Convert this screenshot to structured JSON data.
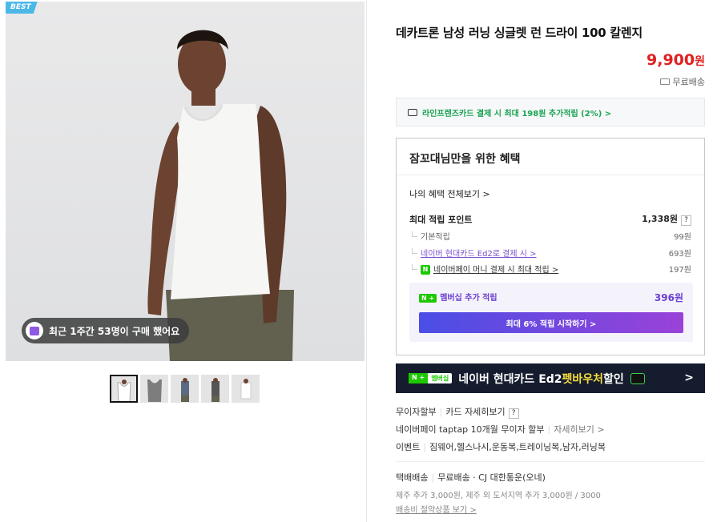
{
  "product": {
    "best_badge": "BEST",
    "recent_buyers": "최근 1주간 53명이 구매 했어요",
    "title": "데카트론 남성 러닝 싱글렛 런 드라이 100 칼렌지",
    "price": "9,900",
    "price_unit": "원",
    "shipping": "무료배송"
  },
  "card_promo": "라인프렌즈카드 결제 시 최대 198원 추가적립 (2%) >",
  "benefit": {
    "heading": "잠꼬대님만을 위한 혜택",
    "all_view": "나의 혜택 전체보기 >",
    "max_points_label": "최대 적립 포인트",
    "max_points_value": "1,338원",
    "help": "?",
    "basic_label": "기본적립",
    "basic_value": "99원",
    "naver_card_label": "네이버 현대카드 Ed2로 결제 시 >",
    "naver_card_value": "693원",
    "npay_icon": "N",
    "npay_label": "네이버페이 머니 결제 시 최대 적립 >",
    "npay_value": "197원",
    "membership_badge": "N +",
    "membership_label": "멤버십 추가 적립",
    "membership_value": "396원",
    "membership_button": "최대 6% 적립 시작하기 >"
  },
  "banner": {
    "badge_left": "N +",
    "badge_right": "멤버십",
    "text_main": "네이버 현대카드 Ed2 ",
    "text_highlight": "펫바우처",
    "text_tail": " 할인",
    "arrow": ">"
  },
  "payment": {
    "installment": "무이자할부",
    "card_detail": "카드 자세히보기",
    "help": "?",
    "taptap": "네이버페이 taptap 10개월 무이자 할부",
    "detail_more": "자세히보기 >",
    "event_label": "이벤트",
    "event_text": "짐웨어,헬스나시,운동복,트레이닝복,남자,러닝복"
  },
  "delivery": {
    "type": "택배배송",
    "free": "무료배송 · CJ 대한통운(오네)",
    "extra": "제주 추가 3,000원, 제주 외 도서지역 추가 3,000원 / 3000",
    "saving_link": "배송비 절약상품 보기 >"
  },
  "colors": {
    "price": "#e02020",
    "accent_green": "#1ec800",
    "membership_purple": "#6a3fd0",
    "banner_bg": "#151c2e"
  }
}
